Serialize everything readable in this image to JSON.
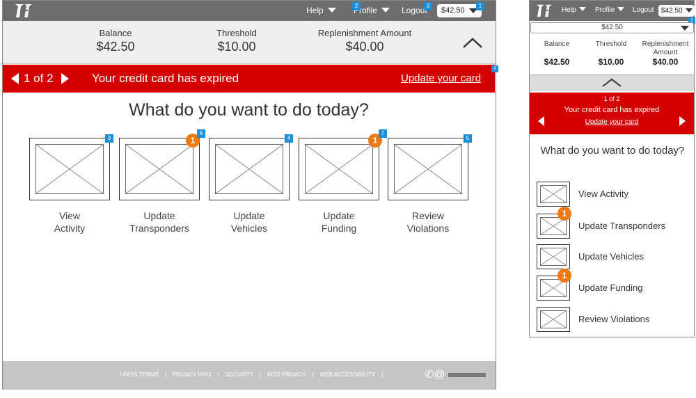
{
  "desktop": {
    "nav": {
      "help_label": "Help",
      "profile_label": "Profile",
      "logout_label": "Logout",
      "balance_pill": "$42.50"
    },
    "badges": {
      "profile": "2",
      "logout": "3",
      "balance": "1",
      "alert": "ii",
      "tile_view_activity": "3",
      "tile_update_transponders": "6",
      "tile_update_vehicles": "4",
      "tile_update_funding": "7",
      "tile_review_violations": "5"
    },
    "summary": {
      "balance_label": "Balance",
      "balance_value": "$42.50",
      "threshold_label": "Threshold",
      "threshold_value": "$10.00",
      "replenishment_label": "Replenishment Amount",
      "replenishment_value": "$40.00"
    },
    "alert": {
      "pager": "1 of 2",
      "message": "Your credit card has expired",
      "link": "Update your card"
    },
    "question": "What do you want to do today?",
    "tiles": [
      {
        "line1": "View",
        "line2": "Activity"
      },
      {
        "line1": "Update",
        "line2": "Transponders",
        "notification": "1"
      },
      {
        "line1": "Update",
        "line2": "Vehicles"
      },
      {
        "line1": "Update",
        "line2": "Funding",
        "notification": "1"
      },
      {
        "line1": "Review",
        "line2": "Violations"
      }
    ],
    "footer": {
      "links": [
        "I-PASS TERMS",
        "PRIVACY INFO",
        "SECURITY",
        "KIDS PRIVACY",
        "WEB ACCESSIBILITY"
      ],
      "separator": "|",
      "contact_icons": "✆@"
    }
  },
  "mobile": {
    "nav": {
      "help_label": "Help",
      "profile_label": "Profile",
      "logout_label": "Logout",
      "balance_pill": "$42.50"
    },
    "badge": "1",
    "select_value": "$42.50",
    "summary": {
      "balance_label": "Balance",
      "balance_value": "$42.50",
      "threshold_label": "Threshold",
      "threshold_value": "$10.00",
      "replenishment_label": "Replenishment Amount",
      "replenishment_value": "$40.00"
    },
    "alert": {
      "pager": "1 of 2",
      "message": "Your credit card has expired",
      "link": "Update your card"
    },
    "question": "What do you want to do today?",
    "items": [
      {
        "label": "View Activity"
      },
      {
        "label": "Update Transponders",
        "notification": "1"
      },
      {
        "label": "Update Vehicles"
      },
      {
        "label": "Update Funding",
        "notification": "1"
      },
      {
        "label": "Review Violations"
      }
    ]
  },
  "colors": {
    "topbar": "#6d6d6d",
    "alert": "#d40000",
    "notification": "#f07a12",
    "annotation_badge": "#1d8fd8",
    "footer": "#c5c5c5"
  },
  "icons": {
    "logo": "ipass-logo-icon",
    "dropdown": "caret-down-icon",
    "collapse": "chevron-up-icon",
    "prev": "arrow-left-icon",
    "next": "arrow-right-icon",
    "placeholder": "image-placeholder-icon",
    "contact": "phone-email-icon"
  }
}
